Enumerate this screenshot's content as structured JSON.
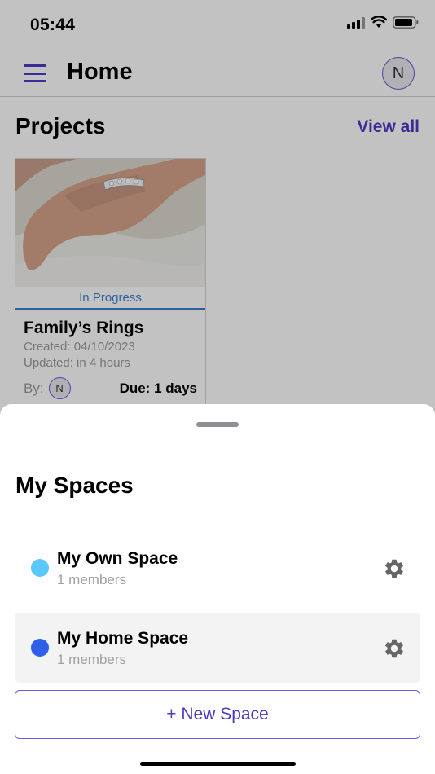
{
  "status_bar": {
    "time": "05:44",
    "icons": [
      "cellular-signal-icon",
      "wifi-icon",
      "battery-icon"
    ]
  },
  "header": {
    "menu_icon": "hamburger-menu-icon",
    "title": "Home",
    "avatar_initial": "N"
  },
  "projects": {
    "section_title": "Projects",
    "view_all_label": "View all",
    "items": [
      {
        "status": "In Progress",
        "name": "Family’s Rings",
        "created": "Created: 04/10/2023",
        "updated": "Updated: in 4 hours",
        "by_label": "By:",
        "owner_initial": "N",
        "due": "Due: 1 days"
      }
    ]
  },
  "spaces_sheet": {
    "title": "My Spaces",
    "spaces": [
      {
        "name": "My Own Space",
        "members": "1 members",
        "dot_color": "#5ac8fa",
        "selected": false
      },
      {
        "name": "My Home Space",
        "members": "1 members",
        "dot_color": "#2f5fe8",
        "selected": true
      }
    ],
    "new_space_label": "+ New Space"
  },
  "colors": {
    "accent": "#4b3cc4",
    "status_blue": "#3f7fd0"
  }
}
